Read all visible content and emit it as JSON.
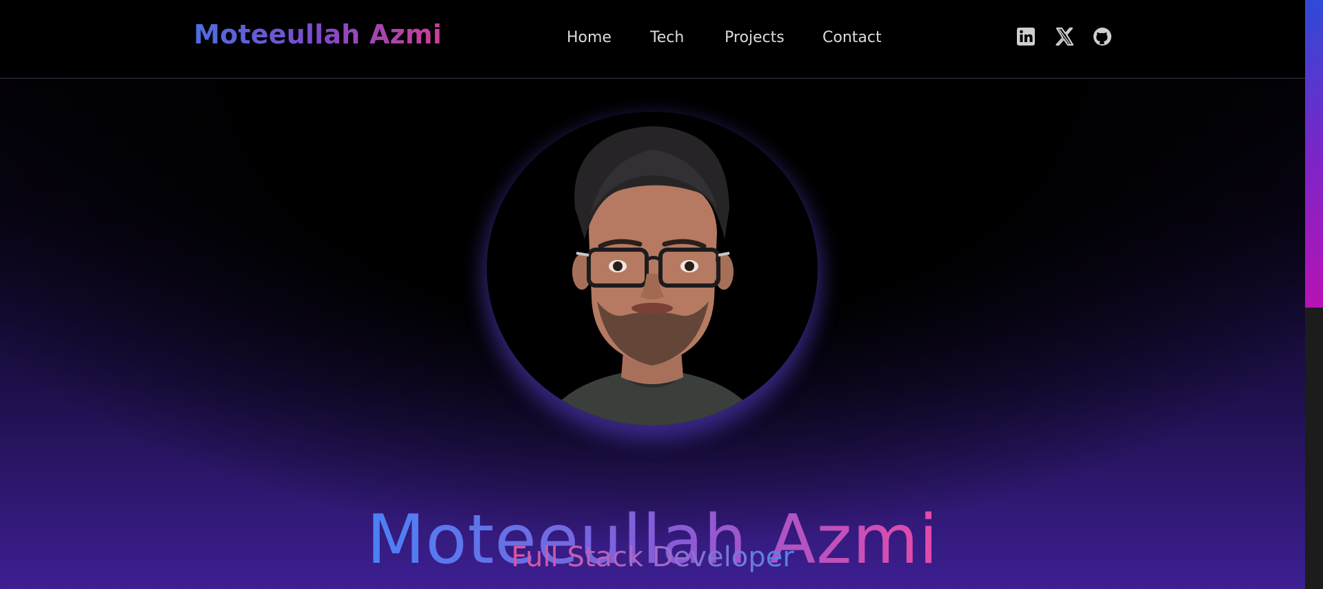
{
  "header": {
    "brand": "Moteeullah Azmi",
    "nav": [
      {
        "label": "Home"
      },
      {
        "label": "Tech"
      },
      {
        "label": "Projects"
      },
      {
        "label": "Contact"
      }
    ],
    "social_icons": [
      "linkedin-icon",
      "x-icon",
      "github-icon"
    ]
  },
  "hero": {
    "name": "Moteeullah Azmi",
    "role": "Full Stack Developer",
    "photo": "profile-photo"
  },
  "colors": {
    "accent_blue": "#4a82f5",
    "accent_purple": "#8a5bd6",
    "accent_pink": "#e54aa8",
    "background": "#000000"
  }
}
